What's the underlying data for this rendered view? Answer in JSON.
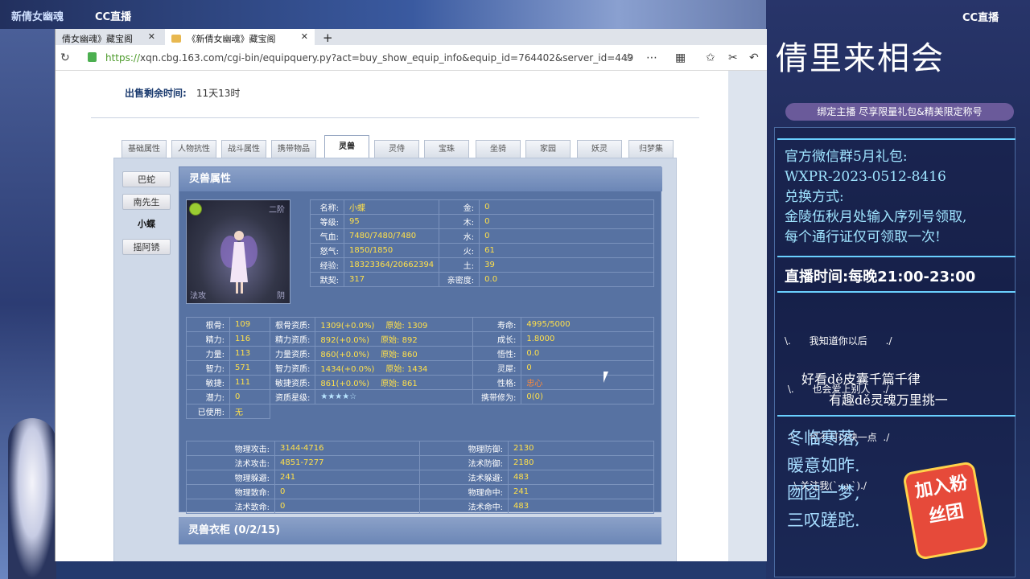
{
  "overlay": {
    "top_left_game": "新倩女幽魂",
    "cc_logo": "CC直播",
    "cc_logo_right": "CC直播",
    "title_art": "倩里来相会",
    "bind_banner": "绑定主播 尽享限量礼包&精美限定称号",
    "gift_lines": [
      "官方微信群5月礼包:",
      " WXPR-2023-0512-8416",
      "兑换方式:",
      "金陵伍秋月处输入序列号领取,",
      "每个通行证仅可领取一次!"
    ],
    "live_time": "直播时间:每晚21:00-23:00",
    "lyrics": [
      "\\.      我知道你以后      ./",
      " \\.      也会爱上别人    ./",
      "  \\.    可不可以快一点  ./",
      "   \\.关注我(`·ω·`)./"
    ],
    "slogan1": "好看dě皮囊千篇千律",
    "slogan2": "有趣dě灵魂万里挑一",
    "poem": [
      "冬临寒落,",
      "暖意如昨.",
      "囫囵一梦,",
      "三叹蹉跎."
    ],
    "join_badge": "加入粉丝团"
  },
  "browser": {
    "tabs": [
      {
        "label": "倩女幽魂》藏宝阁"
      },
      {
        "label": "《新倩女幽魂》藏宝阁"
      }
    ],
    "new_tab": "+",
    "close": "✕",
    "url_scheme": "https://",
    "url_rest": "xqn.cbg.163.com/cgi-bin/equipquery.py?act=buy_show_equip_info&equip_id=764402&server_id=449"
  },
  "page": {
    "sell_time_label": "出售剩余时间:",
    "sell_time_value": "11天13时",
    "tabs": [
      "基础属性",
      "人物抗性",
      "战斗属性",
      "携带物品",
      "灵兽",
      "灵侍",
      "宝珠",
      "坐骑",
      "家园",
      "妖灵",
      "归梦集"
    ],
    "active_tab": "灵兽",
    "side_buttons": [
      "巴蛇",
      "南先生",
      "小蝶",
      "摇阿锈"
    ],
    "active_side": "小蝶",
    "pet_section_title": "灵兽属性",
    "portrait": {
      "level": "二阶",
      "type": "法攻",
      "yinyang": "阴"
    },
    "basic": [
      {
        "l1": "名称:",
        "v1": "小蝶",
        "l2": "金:",
        "v2": "0"
      },
      {
        "l1": "等级:",
        "v1": "95",
        "l2": "木:",
        "v2": "0"
      },
      {
        "l1": "气血:",
        "v1": "7480/7480/7480",
        "l2": "水:",
        "v2": "0"
      },
      {
        "l1": "怒气:",
        "v1": "1850/1850",
        "l2": "火:",
        "v2": "61"
      },
      {
        "l1": "经验:",
        "v1": "18323364/20662394",
        "l2": "土:",
        "v2": "39"
      },
      {
        "l1": "默契:",
        "v1": "317",
        "l2": "亲密度:",
        "v2": "0.0"
      }
    ],
    "attrs": [
      {
        "l1": "根骨:",
        "v1": "109",
        "l2": "根骨资质:",
        "v2": "1309(+0.0%)",
        "orig": "原始: 1309",
        "l3": "寿命:",
        "v3": "4995/5000"
      },
      {
        "l1": "精力:",
        "v1": "116",
        "l2": "精力资质:",
        "v2": "892(+0.0%)",
        "orig": "原始: 892",
        "l3": "成长:",
        "v3": "1.8000"
      },
      {
        "l1": "力量:",
        "v1": "113",
        "l2": "力量资质:",
        "v2": "860(+0.0%)",
        "orig": "原始: 860",
        "l3": "悟性:",
        "v3": "0.0"
      },
      {
        "l1": "智力:",
        "v1": "571",
        "l2": "智力资质:",
        "v2": "1434(+0.0%)",
        "orig": "原始: 1434",
        "l3": "灵犀:",
        "v3": "0"
      },
      {
        "l1": "敏捷:",
        "v1": "111",
        "l2": "敏捷资质:",
        "v2": "861(+0.0%)",
        "orig": "原始: 861",
        "l3": "性格:",
        "v3": "忠心"
      },
      {
        "l1": "潜力:",
        "v1": "0",
        "l2": "资质星级:",
        "v2": "★★★★☆",
        "orig": "",
        "l3": "携带修为:",
        "v3": "0(0)"
      }
    ],
    "used_label": "已使用:",
    "used_value": "无",
    "combat": [
      {
        "l1": "物理攻击:",
        "v1": "3144-4716",
        "l2": "物理防御:",
        "v2": "2130"
      },
      {
        "l1": "法术攻击:",
        "v1": "4851-7277",
        "l2": "法术防御:",
        "v2": "2180"
      },
      {
        "l1": "物理躲避:",
        "v1": "241",
        "l2": "法术躲避:",
        "v2": "483"
      },
      {
        "l1": "物理致命:",
        "v1": "0",
        "l2": "物理命中:",
        "v2": "241"
      },
      {
        "l1": "法术致命:",
        "v1": "0",
        "l2": "法术命中:",
        "v2": "483"
      }
    ],
    "wardrobe_title": "灵兽衣柜 (0/2/15)"
  }
}
